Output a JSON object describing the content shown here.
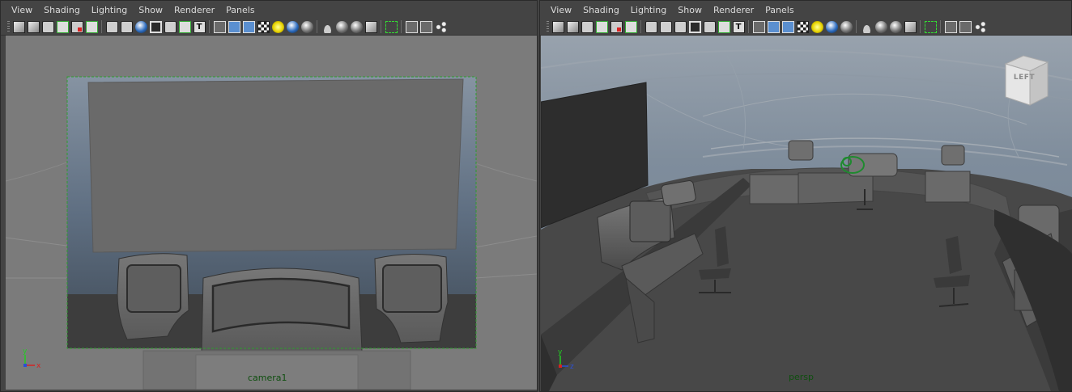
{
  "menus": [
    "View",
    "Shading",
    "Lighting",
    "Show",
    "Renderer",
    "Panels"
  ],
  "toolbar_icons": [
    "camera-attributes-icon",
    "bookmark-icon",
    "image-plane-icon",
    "2d-pan-icon",
    "grease-pencil-icon",
    "film-gate-icon",
    "grid-icon",
    "resolution-gate-icon",
    "gate-mask-icon",
    "field-chart-icon",
    "safe-action-icon",
    "safe-title-icon",
    "texture-icon",
    "wireframe-icon",
    "smooth-shade-icon",
    "shade-wireframe-icon",
    "textured-icon",
    "use-lights-icon",
    "shadows-icon",
    "ambient-occlusion-icon",
    "motion-blur-icon",
    "anti-alias-icon",
    "depth-of-field-icon",
    "xray-icon",
    "isolate-select-icon",
    "xray-joints-icon",
    "xray-active-icon",
    "node-icon"
  ],
  "left_viewport": {
    "camera_label": "camera1",
    "axis": {
      "y": "y",
      "x": "x"
    }
  },
  "right_viewport": {
    "camera_label": "persp",
    "viewcube_label": "LEFT",
    "axis": {
      "y": "y",
      "z": "z"
    }
  },
  "colors": {
    "camera_label": "#0f4f0f",
    "axis_x": "#d62222",
    "axis_y": "#22cc22",
    "axis_z": "#2a4fd6",
    "resolution_gate": "#2e9e2e"
  }
}
